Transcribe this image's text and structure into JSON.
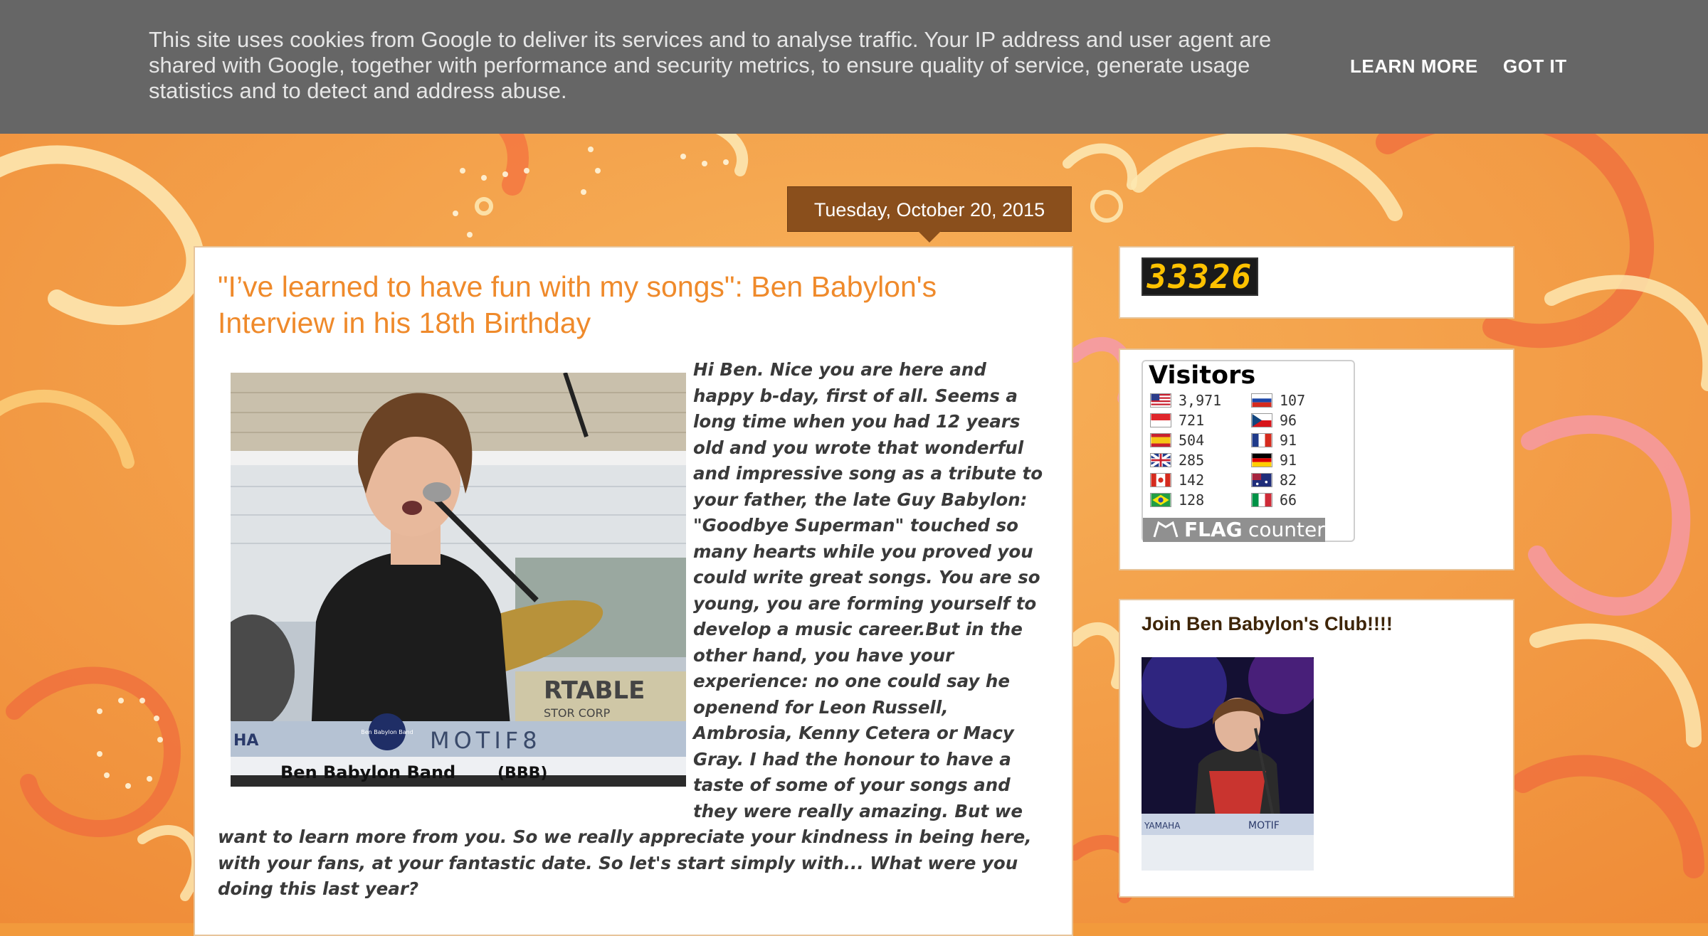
{
  "cookie_banner": {
    "message": "This site uses cookies from Google to deliver its services and to analyse traffic. Your IP address and user agent are shared with Google, together with performance and security metrics, to ensure quality of service, generate usage statistics and to detect and address abuse.",
    "learn_more_label": "LEARN MORE",
    "got_it_label": "GOT IT"
  },
  "post": {
    "date": "Tuesday, October 20, 2015",
    "title": "\"I’ve learned to have fun with my songs\": Ben Babylon's Interview in his 18th Birthday",
    "body": "Hi Ben. Nice you are here and happy b-day, first of all. Seems a long time when you had 12 years old and you wrote that wonderful and impressive song as a tribute to your father, the late Guy Babylon: \"Goodbye Superman\" touched so many hearts while you proved you could write great songs. You are so young, you are forming yourself to develop a music career.But in the other hand, you have your experience: no one could say he openend for Leon Russell, Ambrosia, Kenny Cetera or Macy Gray. I had the honour to have a taste of some of your songs and they were really amazing. But we want to learn more from you. So we really appreciate your kindness in being here, with your fans, at your fantastic date. So let's start simply with... What were you doing this last year?",
    "photo": {
      "banner_text": "Ben Babylon Band",
      "banner_abbrev": "(BBB)",
      "keyboard_text": "MOTIF8",
      "brand_text": "HA",
      "sign_text": "RTABLE",
      "sign_sub_text": "STOR  CORP",
      "badge_text": "Ben Babylon Band"
    }
  },
  "sidebar": {
    "hit_counter": "33326",
    "flag_counter": {
      "title": "Visitors",
      "left_column": [
        {
          "flag": "us-flag-icon",
          "count": "3,971"
        },
        {
          "flag": "sg-flag-icon",
          "count": "721"
        },
        {
          "flag": "es-flag-icon",
          "count": "504"
        },
        {
          "flag": "gb-flag-icon",
          "count": "285"
        },
        {
          "flag": "ca-flag-icon",
          "count": "142"
        },
        {
          "flag": "br-flag-icon",
          "count": "128"
        }
      ],
      "right_column": [
        {
          "flag": "ru-flag-icon",
          "count": "107"
        },
        {
          "flag": "cz-flag-icon",
          "count": "96"
        },
        {
          "flag": "fr-flag-icon",
          "count": "91"
        },
        {
          "flag": "de-flag-icon",
          "count": "91"
        },
        {
          "flag": "au-flag-icon",
          "count": "82"
        },
        {
          "flag": "it-flag-icon",
          "count": "66"
        }
      ],
      "footer_flag": "FLAG",
      "footer_counter": "counter"
    },
    "club": {
      "title": "Join Ben Babylon's Club!!!!",
      "photo": {
        "keyboard_brand": "YAMAHA",
        "keyboard_model": "MOTIF"
      }
    }
  },
  "colors": {
    "background": "#f29a3c",
    "cookie_bar": "#666666",
    "title_orange": "#ef8a2b",
    "date_badge": "#8a4f1c",
    "counter_digits": "#ffc200"
  }
}
